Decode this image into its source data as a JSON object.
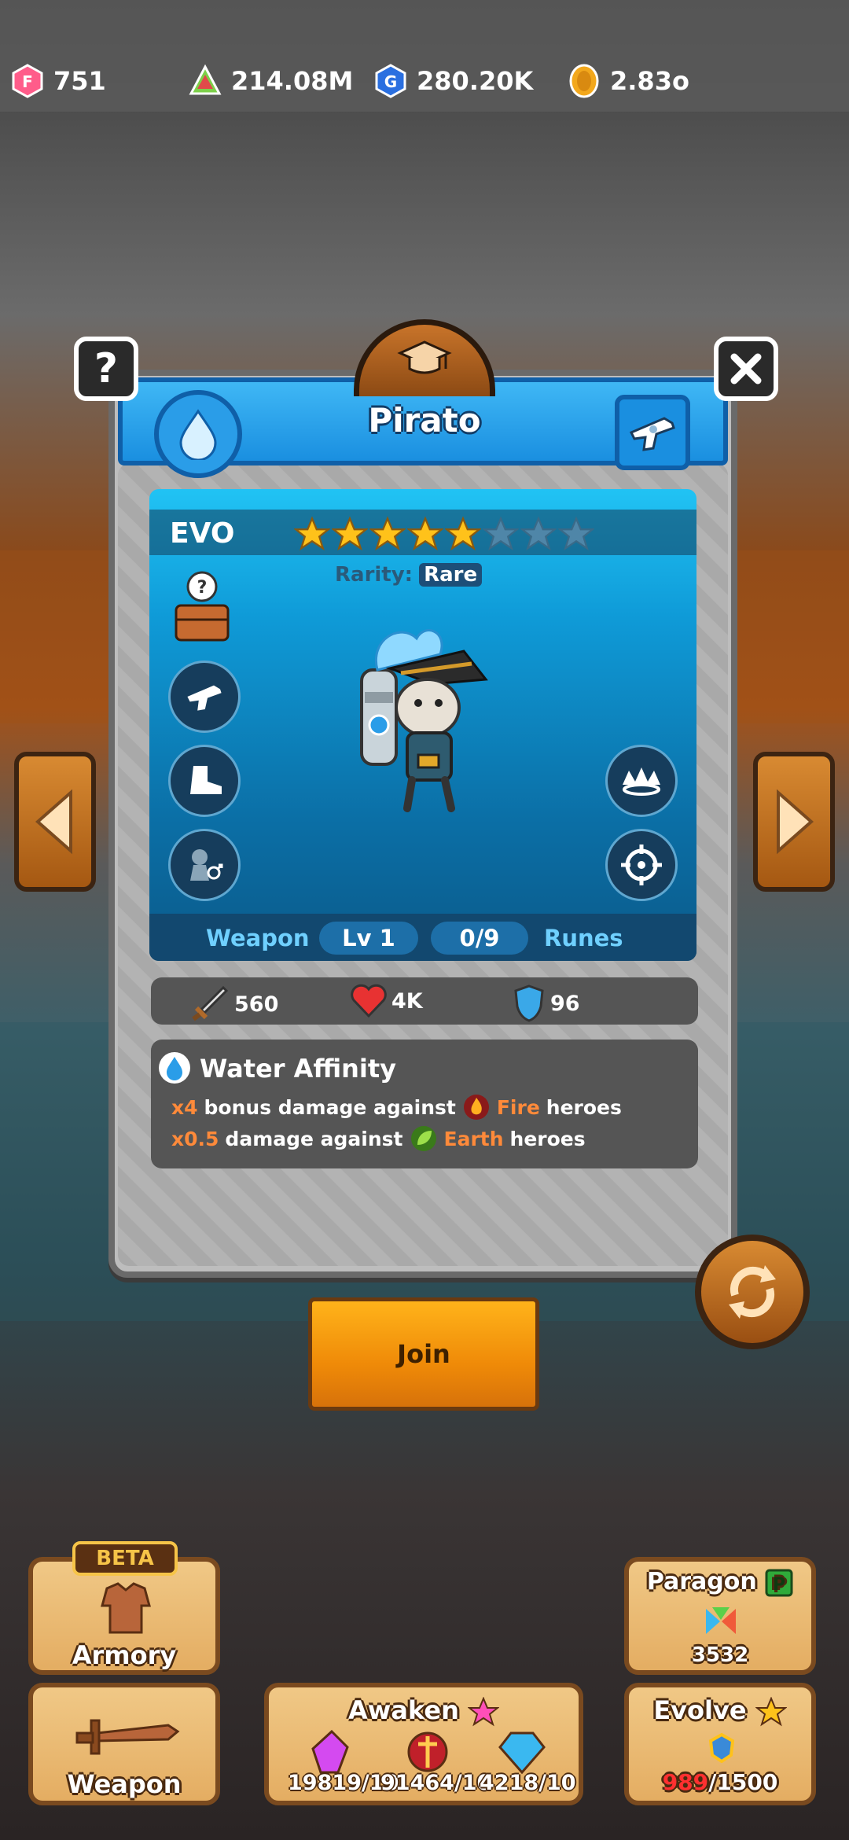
{
  "resources": {
    "gems": "751",
    "triangle": "214.08M",
    "gold_g": "280.20K",
    "coins": "2.83o"
  },
  "panel": {
    "hero_name": "Pirato",
    "help_icon": "question-icon",
    "close_icon": "close-icon",
    "element_icon": "water-drop-icon",
    "weapon_type_icon": "revolver-icon"
  },
  "card": {
    "evo_label": "EVO",
    "stars_total": 8,
    "stars_filled": 5,
    "rarity_label": "Rarity:",
    "rarity_value": "Rare",
    "weapon_label": "Weapon",
    "level": "Lv 1",
    "runes_progress": "0/9",
    "runes_label": "Runes"
  },
  "stats": {
    "attack": "560",
    "health": "4K",
    "defense": "96"
  },
  "affinity": {
    "title": "Water Affinity",
    "line1_mult": "x4",
    "line1_text": "bonus damage against",
    "line1_element": "Fire",
    "line1_suffix": "heroes",
    "line2_mult": "x0.5",
    "line2_text": "damage against",
    "line2_element": "Earth",
    "line2_suffix": "heroes"
  },
  "join_label": "Join",
  "bottom": {
    "beta_label": "BETA",
    "armory_label": "Armory",
    "weapon_label": "Weapon",
    "paragon_label": "Paragon",
    "paragon_value": "3532",
    "awaken_label": "Awaken",
    "awaken_counts": [
      "19819/10",
      "91464/10",
      "4218/10"
    ],
    "evolve_label": "Evolve",
    "evolve_current": "989",
    "evolve_total": "/1500"
  },
  "colors": {
    "accent_blue": "#1a8fe0",
    "join_orange": "#ef8a08",
    "affinity_orange": "#ff8a3a"
  }
}
